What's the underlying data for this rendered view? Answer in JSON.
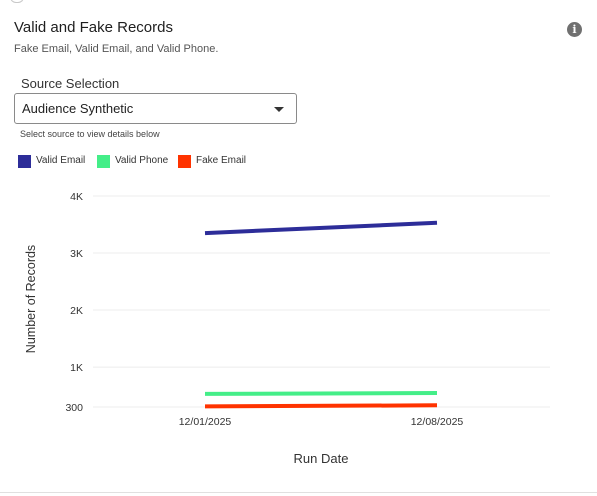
{
  "card": {
    "title": "Valid and Fake Records",
    "subtitle": "Fake Email, Valid Email, and Valid Phone.",
    "info_icon": "info-icon"
  },
  "source": {
    "label": "Source Selection",
    "value": "Audience Synthetic",
    "helper": "Select source to view details below"
  },
  "chart_data": {
    "type": "line",
    "x": [
      "12/01/2025",
      "12/08/2025"
    ],
    "series": [
      {
        "name": "Valid Email",
        "color": "#2d2d99",
        "values": [
          3350,
          3530
        ]
      },
      {
        "name": "Valid Phone",
        "color": "#44ee88",
        "values": [
          530,
          545
        ]
      },
      {
        "name": "Fake Email",
        "color": "#ff3300",
        "values": [
          310,
          330
        ]
      }
    ],
    "ylim": [
      300,
      4000
    ],
    "yticks": [
      300,
      1000,
      2000,
      3000,
      4000
    ],
    "ytick_labels": [
      "300",
      "1K",
      "2K",
      "3K",
      "4K"
    ],
    "xlabel": "Run Date",
    "ylabel": "Number of Records",
    "legend": "top-left",
    "grid": true
  }
}
